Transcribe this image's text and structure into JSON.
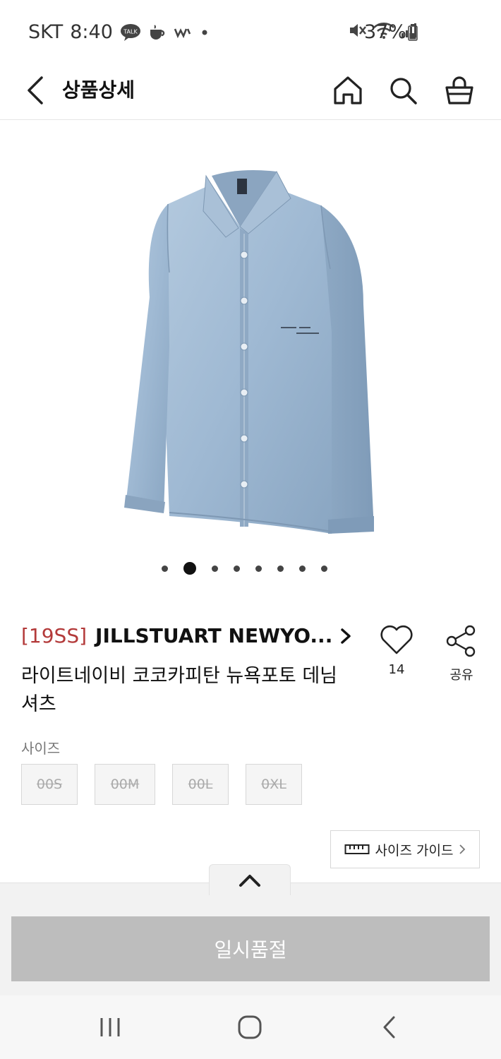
{
  "status_bar": {
    "carrier": "SKT",
    "time": "8:40",
    "talk_badge": "TALK",
    "battery": "37%"
  },
  "header": {
    "title": "상품상세"
  },
  "carousel": {
    "dot_count": 8,
    "active_index": 1
  },
  "product": {
    "season_tag": "[19SS]",
    "brand": "JILLSTUART NEWYO...",
    "name": "라이트네이비 코코카피탄 뉴욕포토 데님셔츠",
    "wish_count": "14",
    "share_label": "공유"
  },
  "size": {
    "label": "사이즈",
    "options": [
      "00S",
      "00M",
      "00L",
      "0XL"
    ],
    "guide_label": "사이즈 가이드"
  },
  "cta": {
    "label": "일시품절"
  },
  "colors": {
    "season_tag": "#b33a3a",
    "denim": "#9fb9d3",
    "button_disabled": "#bdbdbd"
  }
}
